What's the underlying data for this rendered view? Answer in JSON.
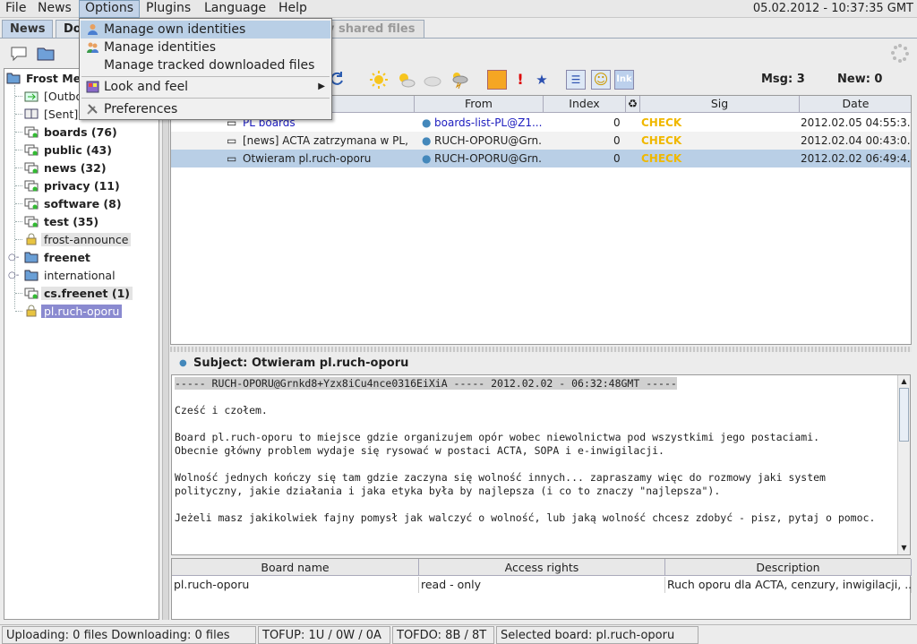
{
  "menubar": {
    "items": [
      "File",
      "News",
      "Options",
      "Plugins",
      "Language",
      "Help"
    ],
    "datetime": "05.02.2012 - 10:37:35 GMT"
  },
  "tabs": [
    "News",
    "Do",
    "y shared files"
  ],
  "options_menu": {
    "items": [
      "Manage own identities",
      "Manage identities",
      "Manage tracked downloaded files",
      "Look and feel",
      "Preferences"
    ]
  },
  "tree": {
    "root": "Frost Mes",
    "items": [
      "[Outbox",
      "[Sent]",
      "boards (76)",
      "public (43)",
      "news (32)",
      "privacy (11)",
      "software (8)",
      "test (35)",
      "frost-announce",
      "freenet",
      "international",
      "cs.freenet (1)",
      "pl.ruch-oporu"
    ]
  },
  "msg_stats": {
    "msg": "Msg: 3",
    "new": "New: 0"
  },
  "msg_table": {
    "headers": [
      "From",
      "Index",
      "Sig",
      "Date"
    ],
    "rows": [
      {
        "subject": "PL boards",
        "from": "boards-list-PL@Z1...",
        "index": "0",
        "sig": "CHECK",
        "date": "2012.02.05 04:55:3..."
      },
      {
        "subject": "[news] ACTA zatrzymana w PL, ...",
        "from": "RUCH-OPORU@Grn...",
        "index": "0",
        "sig": "CHECK",
        "date": "2012.02.04 00:43:0..."
      },
      {
        "subject": "Otwieram pl.ruch-oporu",
        "from": "RUCH-OPORU@Grn...",
        "index": "0",
        "sig": "CHECK",
        "date": "2012.02.02 06:49:4..."
      }
    ]
  },
  "subject": {
    "label": "Subject:",
    "value": "Otwieram pl.ruch-oporu"
  },
  "body": {
    "header": "----- RUCH-OPORU@Grnkd8+Yzx8iCu4nce0316EiXiA ----- 2012.02.02 - 06:32:48GMT -----",
    "lines": [
      "",
      "Cześć i czołem.",
      "",
      "Board pl.ruch-oporu to miejsce gdzie organizujem opór wobec niewolnictwa pod wszystkimi jego postaciami.",
      "Obecnie główny problem wydaje się rysować w postaci ACTA, SOPA i e-inwigilacji.",
      "",
      "Wolność jednych kończy się tam gdzie zaczyna się wolność innych... zapraszamy więc do rozmowy jaki system",
      "polityczny, jakie działania i jaka etyka była by najlepsza (i co to znaczy \"najlepsza\").",
      "",
      "Jeżeli masz jakikolwiek fajny pomysł jak walczyć o wolność, lub jaką wolność chcesz zdobyć - pisz, pytaj o pomoc."
    ]
  },
  "board_table": {
    "headers": [
      "Board name",
      "Access rights",
      "Description"
    ],
    "row": [
      "pl.ruch-oporu",
      "read - only",
      "Ruch oporu dla ACTA, cenzury, inwigilacji, ..."
    ]
  },
  "statusbar": {
    "transfer": "Uploading: 0 files  Downloading: 0 files",
    "tofup": "TOFUP: 1U / 0W / 0A",
    "tofdo": "TOFDO: 8B / 8T",
    "selected_board": "Selected board: pl.ruch-oporu"
  },
  "colors": {
    "accent": "#b9cfe6",
    "check": "#f0b800",
    "selected_board": "#8a8ad0"
  }
}
